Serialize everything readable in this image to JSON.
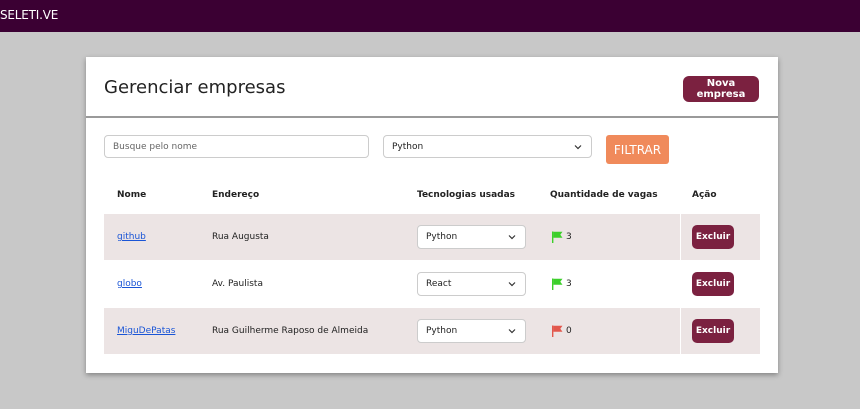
{
  "app": {
    "brand": "SELETI.VE"
  },
  "page": {
    "title": "Gerenciar empresas",
    "new_company_label": "Nova empresa"
  },
  "filters": {
    "search_placeholder": "Busque pelo nome",
    "search_value": "",
    "technology_selected": "Python",
    "filter_label": "FILTRAR"
  },
  "table": {
    "headers": [
      "Nome",
      "Endereço",
      "Tecnologias usadas",
      "Quantidade de vagas",
      "Ação"
    ],
    "rows": [
      {
        "name": "github",
        "address": "Rua Augusta",
        "technology": "Python",
        "jobs": "3",
        "flag": "flag-green",
        "action": "Excluir"
      },
      {
        "name": "globo",
        "address": "Av. Paulista",
        "technology": "React",
        "jobs": "3",
        "flag": "flag-green",
        "action": "Excluir"
      },
      {
        "name": "MiguDePatas",
        "address": "Rua Guilherme Raposo de Almeida",
        "technology": "Python",
        "jobs": "0",
        "flag": "flag-red",
        "action": "Excluir"
      }
    ]
  },
  "colors": {
    "topbar": "#3b0033",
    "primary": "#7b2140",
    "filter_button": "#f08a5b",
    "row_shade": "#ece4e4",
    "flag_green": "#3ccf2a",
    "flag_red": "#e2574c",
    "link": "#1a55d6"
  },
  "icons": {
    "dropdown": "chevron-down-icon",
    "available_jobs": "flag-icon"
  }
}
